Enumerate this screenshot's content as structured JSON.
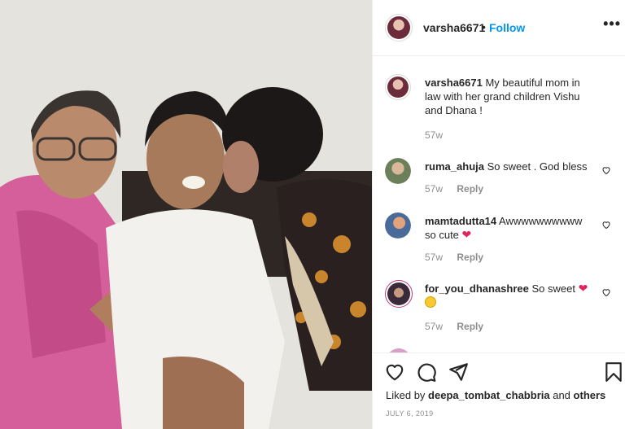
{
  "post": {
    "author": "varsha6671",
    "dot": "•",
    "follow_label": "Follow",
    "more_label": "•••",
    "photo_alt": "",
    "caption": {
      "username": "varsha6671",
      "text": "My beautiful mom in law with her grand children Vishu and Dhana !",
      "age": "57w"
    },
    "comments": [
      {
        "username": "ruma_ahuja",
        "text": "So sweet . God bless",
        "emoji": "",
        "age": "57w",
        "reply_label": "Reply",
        "avatar_color": "#6b7f5a"
      },
      {
        "username": "mamtadutta14",
        "text": "Awwwwwwwwww so cute",
        "emoji": "heart",
        "age": "57w",
        "reply_label": "Reply",
        "avatar_color": "#4a6a9a"
      },
      {
        "username": "for_you_dhanashree",
        "text": "So sweet",
        "emoji": "heart-face",
        "age": "57w",
        "reply_label": "Reply",
        "avatar_color": "#3a2b3a"
      }
    ],
    "actions": {
      "like_icon": "heart-outline-icon",
      "comment_icon": "comment-bubble-icon",
      "share_icon": "paper-plane-icon",
      "save_icon": "bookmark-icon"
    },
    "likes": {
      "prefix": "Liked by",
      "user": "deepa_tombat_chabbria",
      "and": "and",
      "others": "others"
    },
    "date": "JULY 6, 2019"
  },
  "colors": {
    "link_blue": "#0095f6",
    "text": "#262626",
    "muted": "#8e8e8e",
    "border": "#efefef",
    "heart_red": "#e0245e"
  }
}
